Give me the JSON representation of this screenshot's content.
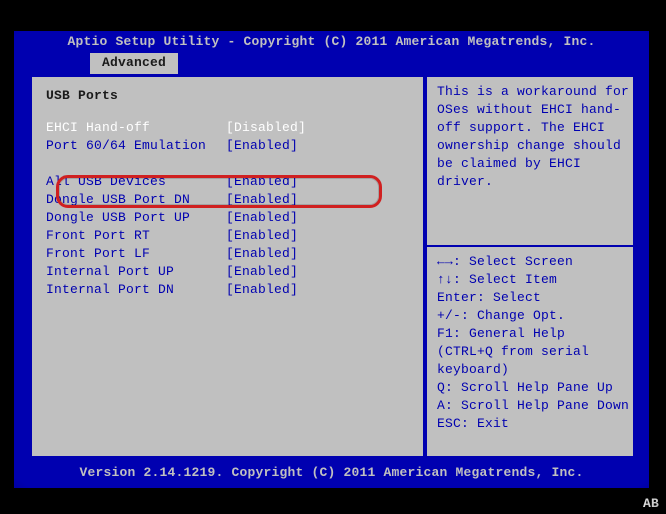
{
  "header": {
    "title": "Aptio Setup Utility - Copyright (C) 2011 American Megatrends, Inc."
  },
  "tab": {
    "label": "Advanced"
  },
  "section": {
    "title": "USB Ports"
  },
  "rows": {
    "ehci": {
      "label": "EHCI Hand-off",
      "value": "[Disabled]"
    },
    "port6064": {
      "label": "Port 60/64 Emulation",
      "value": "[Enabled]"
    },
    "allusb": {
      "label": "All USB Devices",
      "value": "[Enabled]"
    },
    "dongle_dn": {
      "label": "Dongle USB Port DN",
      "value": "[Enabled]"
    },
    "dongle_up": {
      "label": "Dongle USB Port UP",
      "value": "[Enabled]"
    },
    "front_rt": {
      "label": "Front Port RT",
      "value": "[Enabled]"
    },
    "front_lf": {
      "label": "Front Port LF",
      "value": "[Enabled]"
    },
    "internal_up": {
      "label": "Internal Port UP",
      "value": "[Enabled]"
    },
    "internal_dn": {
      "label": "Internal Port DN",
      "value": "[Enabled]"
    }
  },
  "help_text": "This is a workaround for OSes without EHCI hand-off support. The EHCI ownership change should be claimed by EHCI driver.",
  "keys": {
    "l1": "←→: Select Screen",
    "l2": "↑↓: Select Item",
    "l3": "Enter: Select",
    "l4": "+/-: Change Opt.",
    "l5": "F1: General Help",
    "l6": "(CTRL+Q from serial",
    "l7": "keyboard)",
    "l8": "Q: Scroll Help Pane Up",
    "l9": "A: Scroll Help Pane Down",
    "l10": "ESC: Exit"
  },
  "footer": {
    "version": "Version 2.14.1219. Copyright (C) 2011 American Megatrends, Inc."
  },
  "corner_label": "AB"
}
